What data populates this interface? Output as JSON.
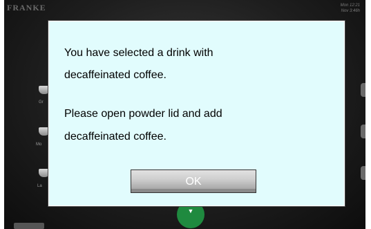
{
  "header": {
    "brand": "FRANKE",
    "clock_line1": "Mon 12:21",
    "clock_line2": "Nov 3:46h"
  },
  "background": {
    "products": [
      {
        "label": "Gr"
      },
      {
        "label": "Mo"
      },
      {
        "label": "La"
      }
    ]
  },
  "dialog": {
    "line1": "You have selected a drink with",
    "line2": "decaffeinated coffee.",
    "line3": "Please open powder lid and add",
    "line4": "decaffeinated coffee.",
    "ok_label": "OK"
  },
  "colors": {
    "dialog_background": "#e1fcfd",
    "screen_background": "#1e1e1e",
    "go_button": "#1f8a3f"
  }
}
